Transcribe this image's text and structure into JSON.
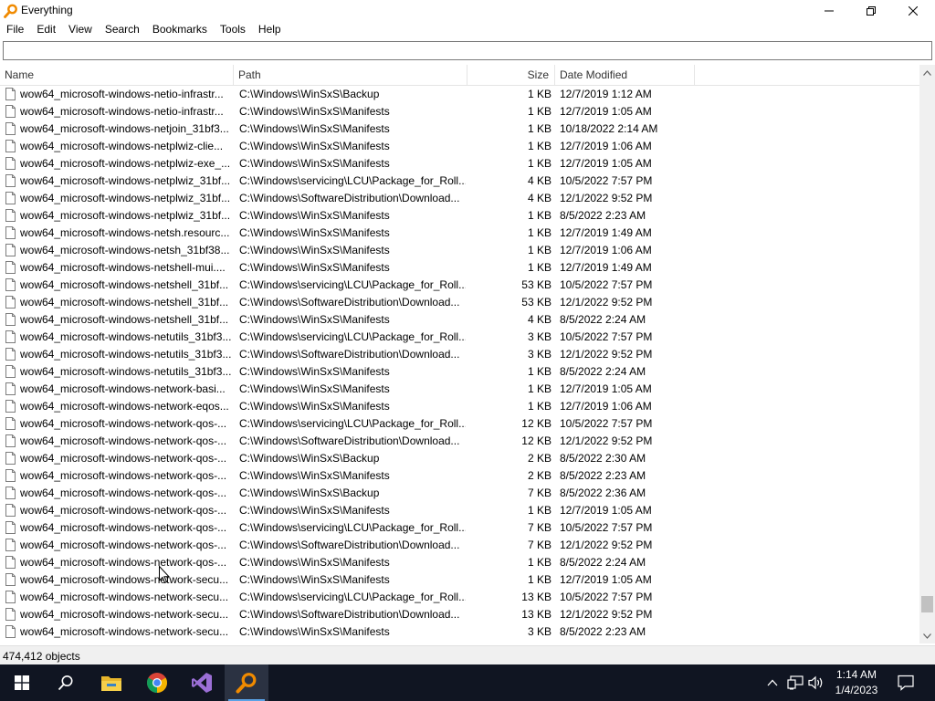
{
  "window": {
    "title": "Everything"
  },
  "menu": [
    "File",
    "Edit",
    "View",
    "Search",
    "Bookmarks",
    "Tools",
    "Help"
  ],
  "search": {
    "value": "",
    "placeholder": ""
  },
  "columns": {
    "name": "Name",
    "path": "Path",
    "size": "Size",
    "date": "Date Modified"
  },
  "rows": [
    {
      "name": "wow64_microsoft-windows-netio-infrastr...",
      "path": "C:\\Windows\\WinSxS\\Backup",
      "size": "1 KB",
      "date": "12/7/2019 1:12 AM"
    },
    {
      "name": "wow64_microsoft-windows-netio-infrastr...",
      "path": "C:\\Windows\\WinSxS\\Manifests",
      "size": "1 KB",
      "date": "12/7/2019 1:05 AM"
    },
    {
      "name": "wow64_microsoft-windows-netjoin_31bf3...",
      "path": "C:\\Windows\\WinSxS\\Manifests",
      "size": "1 KB",
      "date": "10/18/2022 2:14 AM"
    },
    {
      "name": "wow64_microsoft-windows-netplwiz-clie...",
      "path": "C:\\Windows\\WinSxS\\Manifests",
      "size": "1 KB",
      "date": "12/7/2019 1:06 AM"
    },
    {
      "name": "wow64_microsoft-windows-netplwiz-exe_...",
      "path": "C:\\Windows\\WinSxS\\Manifests",
      "size": "1 KB",
      "date": "12/7/2019 1:05 AM"
    },
    {
      "name": "wow64_microsoft-windows-netplwiz_31bf...",
      "path": "C:\\Windows\\servicing\\LCU\\Package_for_Roll...",
      "size": "4 KB",
      "date": "10/5/2022 7:57 PM"
    },
    {
      "name": "wow64_microsoft-windows-netplwiz_31bf...",
      "path": "C:\\Windows\\SoftwareDistribution\\Download...",
      "size": "4 KB",
      "date": "12/1/2022 9:52 PM"
    },
    {
      "name": "wow64_microsoft-windows-netplwiz_31bf...",
      "path": "C:\\Windows\\WinSxS\\Manifests",
      "size": "1 KB",
      "date": "8/5/2022 2:23 AM"
    },
    {
      "name": "wow64_microsoft-windows-netsh.resourc...",
      "path": "C:\\Windows\\WinSxS\\Manifests",
      "size": "1 KB",
      "date": "12/7/2019 1:49 AM"
    },
    {
      "name": "wow64_microsoft-windows-netsh_31bf38...",
      "path": "C:\\Windows\\WinSxS\\Manifests",
      "size": "1 KB",
      "date": "12/7/2019 1:06 AM"
    },
    {
      "name": "wow64_microsoft-windows-netshell-mui....",
      "path": "C:\\Windows\\WinSxS\\Manifests",
      "size": "1 KB",
      "date": "12/7/2019 1:49 AM"
    },
    {
      "name": "wow64_microsoft-windows-netshell_31bf...",
      "path": "C:\\Windows\\servicing\\LCU\\Package_for_Roll...",
      "size": "53 KB",
      "date": "10/5/2022 7:57 PM"
    },
    {
      "name": "wow64_microsoft-windows-netshell_31bf...",
      "path": "C:\\Windows\\SoftwareDistribution\\Download...",
      "size": "53 KB",
      "date": "12/1/2022 9:52 PM"
    },
    {
      "name": "wow64_microsoft-windows-netshell_31bf...",
      "path": "C:\\Windows\\WinSxS\\Manifests",
      "size": "4 KB",
      "date": "8/5/2022 2:24 AM"
    },
    {
      "name": "wow64_microsoft-windows-netutils_31bf3...",
      "path": "C:\\Windows\\servicing\\LCU\\Package_for_Roll...",
      "size": "3 KB",
      "date": "10/5/2022 7:57 PM"
    },
    {
      "name": "wow64_microsoft-windows-netutils_31bf3...",
      "path": "C:\\Windows\\SoftwareDistribution\\Download...",
      "size": "3 KB",
      "date": "12/1/2022 9:52 PM"
    },
    {
      "name": "wow64_microsoft-windows-netutils_31bf3...",
      "path": "C:\\Windows\\WinSxS\\Manifests",
      "size": "1 KB",
      "date": "8/5/2022 2:24 AM"
    },
    {
      "name": "wow64_microsoft-windows-network-basi...",
      "path": "C:\\Windows\\WinSxS\\Manifests",
      "size": "1 KB",
      "date": "12/7/2019 1:05 AM"
    },
    {
      "name": "wow64_microsoft-windows-network-eqos...",
      "path": "C:\\Windows\\WinSxS\\Manifests",
      "size": "1 KB",
      "date": "12/7/2019 1:06 AM"
    },
    {
      "name": "wow64_microsoft-windows-network-qos-...",
      "path": "C:\\Windows\\servicing\\LCU\\Package_for_Roll...",
      "size": "12 KB",
      "date": "10/5/2022 7:57 PM"
    },
    {
      "name": "wow64_microsoft-windows-network-qos-...",
      "path": "C:\\Windows\\SoftwareDistribution\\Download...",
      "size": "12 KB",
      "date": "12/1/2022 9:52 PM"
    },
    {
      "name": "wow64_microsoft-windows-network-qos-...",
      "path": "C:\\Windows\\WinSxS\\Backup",
      "size": "2 KB",
      "date": "8/5/2022 2:30 AM"
    },
    {
      "name": "wow64_microsoft-windows-network-qos-...",
      "path": "C:\\Windows\\WinSxS\\Manifests",
      "size": "2 KB",
      "date": "8/5/2022 2:23 AM"
    },
    {
      "name": "wow64_microsoft-windows-network-qos-...",
      "path": "C:\\Windows\\WinSxS\\Backup",
      "size": "7 KB",
      "date": "8/5/2022 2:36 AM"
    },
    {
      "name": "wow64_microsoft-windows-network-qos-...",
      "path": "C:\\Windows\\WinSxS\\Manifests",
      "size": "1 KB",
      "date": "12/7/2019 1:05 AM"
    },
    {
      "name": "wow64_microsoft-windows-network-qos-...",
      "path": "C:\\Windows\\servicing\\LCU\\Package_for_Roll...",
      "size": "7 KB",
      "date": "10/5/2022 7:57 PM"
    },
    {
      "name": "wow64_microsoft-windows-network-qos-...",
      "path": "C:\\Windows\\SoftwareDistribution\\Download...",
      "size": "7 KB",
      "date": "12/1/2022 9:52 PM"
    },
    {
      "name": "wow64_microsoft-windows-network-qos-...",
      "path": "C:\\Windows\\WinSxS\\Manifests",
      "size": "1 KB",
      "date": "8/5/2022 2:24 AM"
    },
    {
      "name": "wow64_microsoft-windows-network-secu...",
      "path": "C:\\Windows\\WinSxS\\Manifests",
      "size": "1 KB",
      "date": "12/7/2019 1:05 AM"
    },
    {
      "name": "wow64_microsoft-windows-network-secu...",
      "path": "C:\\Windows\\servicing\\LCU\\Package_for_Roll...",
      "size": "13 KB",
      "date": "10/5/2022 7:57 PM"
    },
    {
      "name": "wow64_microsoft-windows-network-secu...",
      "path": "C:\\Windows\\SoftwareDistribution\\Download...",
      "size": "13 KB",
      "date": "12/1/2022 9:52 PM"
    },
    {
      "name": "wow64_microsoft-windows-network-secu...",
      "path": "C:\\Windows\\WinSxS\\Manifests",
      "size": "3 KB",
      "date": "8/5/2022 2:23 AM"
    }
  ],
  "status": {
    "objects": "474,412 objects"
  },
  "taskbar": {
    "apps": [
      "start-icon",
      "search-icon",
      "file-explorer-icon",
      "chrome-icon",
      "visual-studio-icon",
      "everything-icon"
    ],
    "clock": {
      "time": "1:14 AM",
      "date": "1/4/2023"
    }
  },
  "colors": {
    "taskbar": "#101522",
    "accent": "#5aa2e6",
    "everything_icon": "#f08a00"
  }
}
